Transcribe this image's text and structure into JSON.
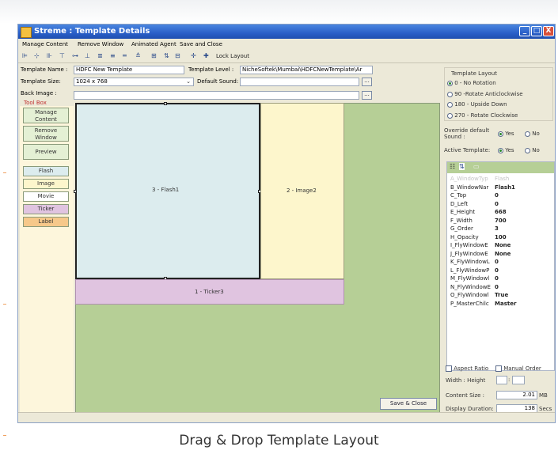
{
  "window": {
    "title": "Streme  : Template Details",
    "controls": [
      "_",
      "□",
      "X"
    ]
  },
  "menu": {
    "items": [
      "Manage Content",
      "Remove Window",
      "Animated Agent",
      "Save and Close"
    ]
  },
  "toolbar": {
    "lock_label": "Lock Layout"
  },
  "form": {
    "template_name_label": "Template Name :",
    "template_name_value": "HDFC New Template",
    "template_size_label": "Template Size:",
    "template_size_value": "1024 x 768",
    "back_image_label": "Back Image :",
    "template_level_label": "Template Level :",
    "template_level_value": "NicheSoftek\\Mumbai\\HDFCNewTemplate\\Ar",
    "default_sound_label": "Default Sound:",
    "browse_label": "..."
  },
  "toolbox": {
    "title": "Tool Box",
    "actions": [
      "Manage Content",
      "Remove Window",
      "Preview"
    ],
    "types": [
      "Flash",
      "Image",
      "Movie",
      "Ticker",
      "Label"
    ],
    "colors": {
      "Flash": "#dcecee",
      "Image": "#fdf6cc",
      "Movie": "#ffffff",
      "Ticker": "#e0c4e0",
      "Label": "#f6c88a"
    }
  },
  "canvas": {
    "regions": {
      "flash": "3 - Flash1",
      "image": "2 - Image2",
      "ticker": "1 - Ticker3"
    }
  },
  "right": {
    "layout_title": "Template Layout",
    "layout_options": [
      "0 - No Rotation",
      "90 -Rotate Anticlockwise",
      "180 - Upside Down",
      "270 - Rotate Clockwise"
    ],
    "layout_selected": 0,
    "override_label": "Override default Sound :",
    "active_label": "Active Template:",
    "yes": "Yes",
    "no": "No",
    "aspect_ratio": "Aspect Ratio",
    "manual_order": "Manual Order",
    "width_height": "Width : Height",
    "width_height_sep": ":",
    "content_size_label": "Content Size :",
    "content_size_value": "2.01",
    "content_size_unit": "MB",
    "display_duration_label": "Display Duration:",
    "display_duration_value": "138",
    "display_duration_unit": "Secs"
  },
  "properties": [
    {
      "name": "A_WindowTyp",
      "value": "Flash",
      "dim": true
    },
    {
      "name": "B_WindowNar",
      "value": "Flash1"
    },
    {
      "name": "C_Top",
      "value": "0"
    },
    {
      "name": "D_Left",
      "value": "0"
    },
    {
      "name": "E_Height",
      "value": "668"
    },
    {
      "name": "F_Width",
      "value": "700"
    },
    {
      "name": "G_Order",
      "value": "3"
    },
    {
      "name": "H_Opacity",
      "value": "100"
    },
    {
      "name": "I_FlyWindowE",
      "value": "None"
    },
    {
      "name": "J_FlyWindowE",
      "value": "None"
    },
    {
      "name": "K_FlyWindowL",
      "value": "0"
    },
    {
      "name": "L_FlyWindowP",
      "value": "0"
    },
    {
      "name": "M_FlyWindowl",
      "value": "0"
    },
    {
      "name": "N_FlyWindowE",
      "value": "0"
    },
    {
      "name": "O_FlyWindowl",
      "value": "True"
    },
    {
      "name": "P_MasterChilc",
      "value": "Master"
    }
  ],
  "buttons": {
    "save_close": "Save & Close"
  },
  "caption": "Drag & Drop Template Layout"
}
